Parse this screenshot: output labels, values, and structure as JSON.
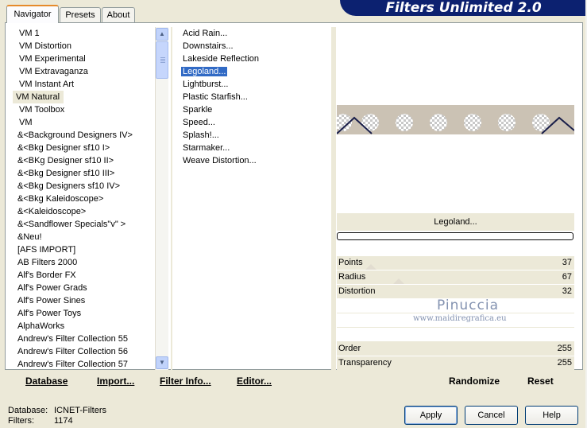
{
  "app_title": "Filters Unlimited 2.0",
  "tabs": [
    "Navigator",
    "Presets",
    "About"
  ],
  "categories": [
    "VM 1",
    "VM Distortion",
    "VM Experimental",
    "VM Extravaganza",
    "VM Instant Art",
    "VM Natural",
    "VM Toolbox",
    "VM",
    "&<Background Designers IV>",
    "&<Bkg Designer sf10 I>",
    "&<BKg Designer sf10 II>",
    "&<Bkg Designer sf10 III>",
    "&<Bkg Designers sf10 IV>",
    "&<Bkg Kaleidoscope>",
    "&<Kaleidoscope>",
    "&<Sandflower Specials\"v\" >",
    "&Neu!",
    "[AFS IMPORT]",
    "AB Filters 2000",
    "Alf's Border FX",
    "Alf's Power Grads",
    "Alf's Power Sines",
    "Alf's Power Toys",
    "AlphaWorks",
    "Andrew's Filter Collection 55",
    "Andrew's Filter Collection 56",
    "Andrew's Filter Collection 57"
  ],
  "selected_category": "VM Natural",
  "filters": [
    "Acid Rain...",
    "Downstairs...",
    "Lakeside Reflection",
    "Legoland...",
    "Lightburst...",
    "Plastic Starfish...",
    "Sparkle",
    "Speed...",
    "Splash!...",
    "Starmaker...",
    "Weave Distortion..."
  ],
  "selected_filter": "Legoland...",
  "preview_title": "Legoland...",
  "params": {
    "points": {
      "label": "Points",
      "value": "37"
    },
    "radius": {
      "label": "Radius",
      "value": "67"
    },
    "distortion": {
      "label": "Distortion",
      "value": "32"
    },
    "order": {
      "label": "Order",
      "value": "255"
    },
    "transparency": {
      "label": "Transparency",
      "value": "255"
    }
  },
  "watermark": {
    "name": "Pinuccia",
    "url": "www.maidiregrafica.eu"
  },
  "bottom_links": {
    "database": "Database",
    "import": "Import...",
    "filter_info": "Filter Info...",
    "editor": "Editor...",
    "randomize": "Randomize",
    "reset": "Reset"
  },
  "status": {
    "database_label": "Database:",
    "database_value": "ICNET-Filters",
    "filters_label": "Filters:",
    "filters_value": "1174"
  },
  "buttons": {
    "apply": "Apply",
    "cancel": "Cancel",
    "help": "Help"
  },
  "colors": {
    "banner": "#0c2170",
    "selection": "#316ac5",
    "tab_highlight": "#e68b2c"
  }
}
